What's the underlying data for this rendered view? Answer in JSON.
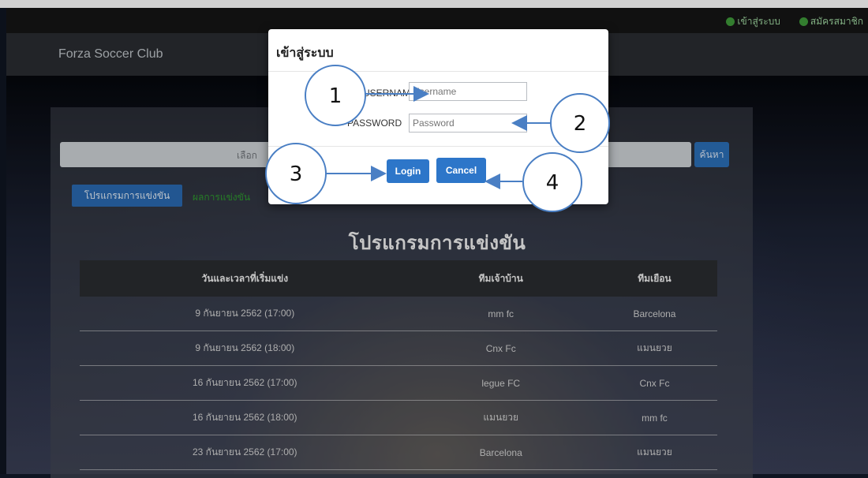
{
  "nav": {
    "links": [
      {
        "label": "เข้าสู่ระบบ",
        "icon": "login-icon"
      },
      {
        "label": "สมัครสมาชิก",
        "icon": "register-icon"
      }
    ],
    "brand": "Forza Soccer Club"
  },
  "search": {
    "placeholder_visible": "เลือก",
    "button": "ค้นหา"
  },
  "tabs": [
    {
      "label": "โปรแกรมการแข่งขัน",
      "active": true
    },
    {
      "label": "ผลการแข่งขัน",
      "active": false
    }
  ],
  "schedule": {
    "title": "โปรแกรมการแข่งขัน",
    "headers": [
      "วันและเวลาที่เริ่มแข่ง",
      "ทีมเจ้าบ้าน",
      "ทีมเยือน"
    ],
    "rows": [
      [
        "9 กันยายน 2562 (17:00)",
        "mm fc",
        "Barcelona"
      ],
      [
        "9 กันยายน 2562 (18:00)",
        "Cnx Fc",
        "แมนยวย"
      ],
      [
        "16 กันยายน 2562 (17:00)",
        "legue FC",
        "Cnx Fc"
      ],
      [
        "16 กันยายน 2562 (18:00)",
        "แมนยวย",
        "mm fc"
      ],
      [
        "23 กันยายน 2562 (17:00)",
        "Barcelona",
        "แมนยวย"
      ]
    ]
  },
  "modal": {
    "title": "เข้าสู่ระบบ",
    "username_label": "USERNAME",
    "username_placeholder": "Username",
    "password_label": "PASSWORD",
    "password_placeholder": "Password",
    "login_button": "Login",
    "cancel_button": "Cancel"
  },
  "annotations": [
    "1",
    "2",
    "3",
    "4"
  ],
  "colors": {
    "primary": "#2d76c9",
    "green_link": "#2f9a2f",
    "callout_stroke": "#4a7fc4"
  }
}
